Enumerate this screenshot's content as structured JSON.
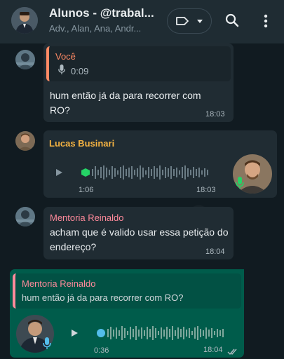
{
  "header": {
    "title": "Alunos - @trabal...",
    "subtitle": "Adv., Alan, Ana, Andr..."
  },
  "icons": {
    "label": "label-icon",
    "caret": "caret-down-icon",
    "search": "search-icon",
    "menu": "more-vert-icon",
    "mic": "mic-icon",
    "play": "play-icon",
    "read": "double-check-icon"
  },
  "messages": {
    "m1": {
      "quote_sender": "Você",
      "quote_duration": "0:09",
      "text": "hum então já da para recorrer com RO?",
      "time": "18:03"
    },
    "m2": {
      "sender": "Lucas Businari",
      "duration": "1:06",
      "time": "18:03"
    },
    "m3": {
      "sender": "Mentoria Reinaldo",
      "text": "acham que é valido usar essa petição do endereço?",
      "time": "18:04"
    },
    "m4": {
      "quote_sender": "Mentoria Reinaldo",
      "quote_text": "hum então já da para recorrer com RO?",
      "duration": "0:36",
      "time": "18:04"
    }
  },
  "colors": {
    "outgoing_bubble": "#005c4b",
    "incoming_bubble": "#202c33",
    "sender_lucas": "#f5b342",
    "sender_mentoria": "#ff8a9b",
    "quote_voce": "#ff8a65",
    "voice_dot_green": "#25d366",
    "voice_dot_blue": "#53bdeb"
  }
}
